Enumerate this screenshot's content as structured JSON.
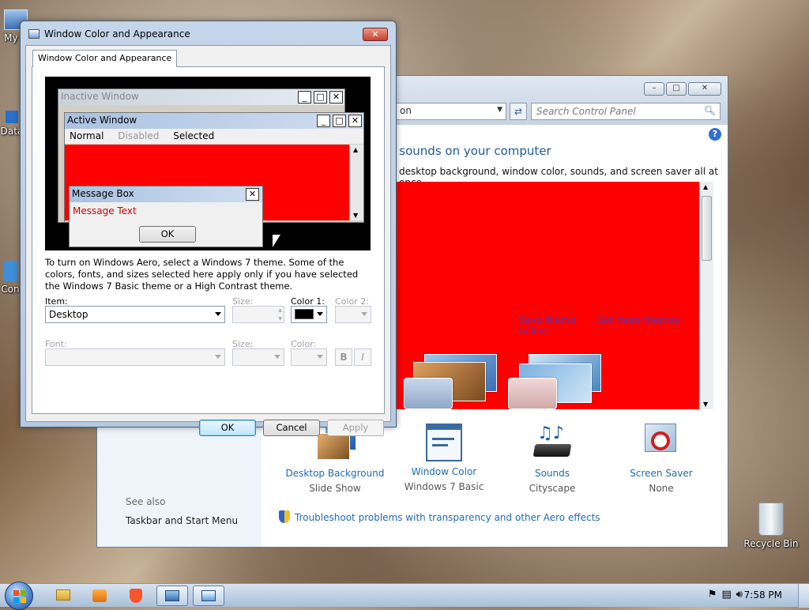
{
  "desktop": {
    "icons": [
      {
        "label": "My C",
        "icon": "computer-icon"
      },
      {
        "label": "Data",
        "icon": "shortcut-icon"
      },
      {
        "label": "Con",
        "icon": "shortcut-icon"
      },
      {
        "label": "Recycle Bin",
        "icon": "recycle-bin-icon"
      }
    ]
  },
  "control_panel": {
    "address_text": "on",
    "search_placeholder": "Search Control Panel",
    "heading": "d sounds on your computer",
    "subheading": "desktop background, window color, sounds, and screen saver all at once.",
    "theme_links": [
      "Save theme",
      "Get more themes online"
    ],
    "see_also": "See also",
    "see_also_link": "Taskbar and Start Menu",
    "bottom_items": [
      {
        "title": "Desktop Background",
        "value": "Slide Show",
        "icon": "desktop-background-icon"
      },
      {
        "title": "Window Color",
        "value": "Windows 7 Basic",
        "icon": "window-color-icon"
      },
      {
        "title": "Sounds",
        "value": "Cityscape",
        "icon": "sounds-icon"
      },
      {
        "title": "Screen Saver",
        "value": "None",
        "icon": "screen-saver-icon"
      }
    ],
    "troubleshoot": "Troubleshoot problems with transparency and other Aero effects",
    "theme_area_color": "#ff0000"
  },
  "dialog": {
    "title": "Window Color and Appearance",
    "tab": "Window Color and Appearance",
    "preview": {
      "inactive_title": "Inactive Window",
      "active_title": "Active Window",
      "menu": [
        "Normal",
        "Disabled",
        "Selected"
      ],
      "message_box_title": "Message Box",
      "message_text": "Message Text",
      "ok": "OK"
    },
    "description": "To turn on Windows Aero, select a Windows 7 theme.  Some of the colors, fonts, and sizes selected here apply only if you have selected the Windows 7 Basic theme or a High Contrast theme.",
    "labels": {
      "item": "Item:",
      "size": "Size:",
      "color1": "Color 1:",
      "color2": "Color 2:",
      "font": "Font:",
      "font_size": "Size:",
      "font_color": "Color:",
      "bold": "B",
      "italic": "I"
    },
    "item_value": "Desktop",
    "color1_value": "#000000",
    "buttons": {
      "ok": "OK",
      "cancel": "Cancel",
      "apply": "Apply"
    }
  },
  "taskbar": {
    "time": "7:58 PM",
    "apps": [
      "explorer-icon",
      "media-player-icon",
      "brave-icon",
      "control-panel-icon",
      "display-settings-icon"
    ]
  }
}
